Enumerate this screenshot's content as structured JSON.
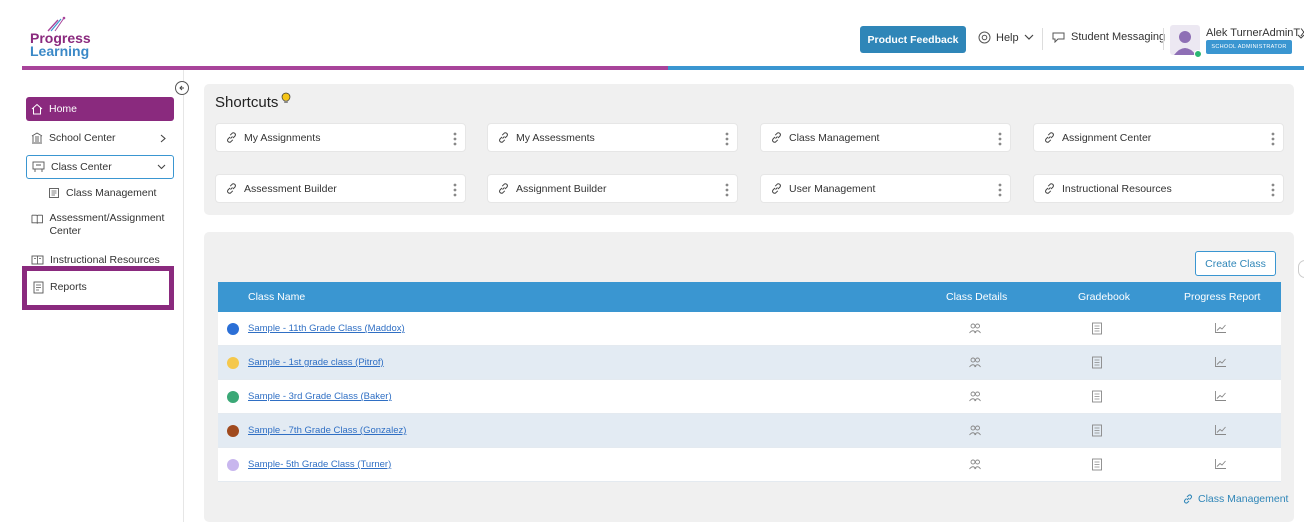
{
  "brand": {
    "line1": "Progress",
    "line2": "Learning"
  },
  "header": {
    "feedback_label": "Product Feedback",
    "help_label": "Help",
    "messaging_label": "Student Messaging",
    "user_name": "Alek TurnerAdminTX",
    "user_role": "SCHOOL ADMINISTRATOR"
  },
  "sidebar": {
    "items": [
      {
        "label": "Home",
        "icon": "home-icon"
      },
      {
        "label": "School Center",
        "icon": "school-icon"
      },
      {
        "label": "Class Center",
        "icon": "class-icon"
      },
      {
        "label": "Class Management",
        "icon": "class-management-icon"
      },
      {
        "label": "Assessment/Assignment Center",
        "icon": "assessment-icon"
      },
      {
        "label": "Instructional Resources",
        "icon": "book-icon"
      },
      {
        "label": "Reports",
        "icon": "report-icon"
      }
    ]
  },
  "shortcuts": {
    "title": "Shortcuts",
    "items": [
      "My Assignments",
      "My Assessments",
      "Class Management",
      "Assignment Center",
      "Assessment Builder",
      "Assignment Builder",
      "User Management",
      "Instructional Resources"
    ]
  },
  "classes": {
    "create_label": "Create Class",
    "columns": [
      "Class Name",
      "Class Details",
      "Gradebook",
      "Progress Report"
    ],
    "rows": [
      {
        "name": "Sample - 11th Grade Class (Maddox)",
        "color": "#2b6fd6"
      },
      {
        "name": "Sample - 1st grade class (Pitrof)",
        "color": "#f5c84c"
      },
      {
        "name": "Sample - 3rd Grade Class (Baker)",
        "color": "#3aa876"
      },
      {
        "name": "Sample - 7th Grade Class (Gonzalez)",
        "color": "#a04a1e"
      },
      {
        "name": "Sample- 5th Grade Class (Turner)",
        "color": "#c8b6ee"
      }
    ],
    "footer_link": "Class Management"
  },
  "colors": {
    "brand_purple": "#8a2a7e",
    "brand_blue": "#3a96d1"
  }
}
